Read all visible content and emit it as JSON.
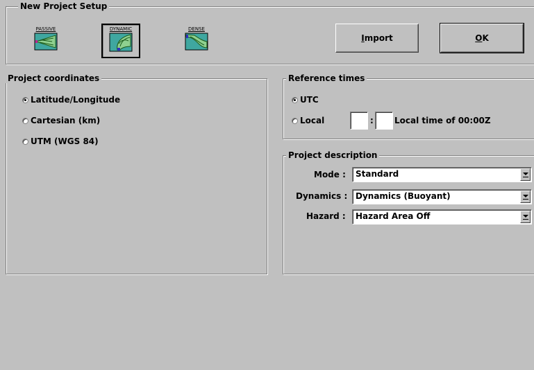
{
  "setup": {
    "title": "New Project Setup",
    "tools": [
      {
        "label": "PASSIVE"
      },
      {
        "label": "DYNAMIC"
      },
      {
        "label": "DENSE"
      }
    ],
    "import_label": "Import",
    "ok_label": "OK"
  },
  "coordinates": {
    "title": "Project coordinates",
    "options": [
      {
        "label": "Latitude/Longitude",
        "selected": true
      },
      {
        "label": "Cartesian (km)",
        "selected": false
      },
      {
        "label": "UTM (WGS 84)",
        "selected": false
      }
    ]
  },
  "reference_times": {
    "title": "Reference times",
    "utc_label": "UTC",
    "local_label": "Local",
    "colon": ":",
    "hour_value": "",
    "minute_value": "",
    "local_note": "Local time of 00:00Z",
    "selected": "UTC"
  },
  "description": {
    "title": "Project description",
    "mode_label": "Mode :",
    "mode_value": "Standard",
    "dynamics_label": "Dynamics :",
    "dynamics_value": "Dynamics (Buoyant)",
    "hazard_label": "Hazard :",
    "hazard_value": "Hazard Area Off"
  },
  "colors": {
    "face": "#c0c0c0",
    "icon_teal": "#3fa7a0",
    "icon_green": "#8fd08f"
  }
}
